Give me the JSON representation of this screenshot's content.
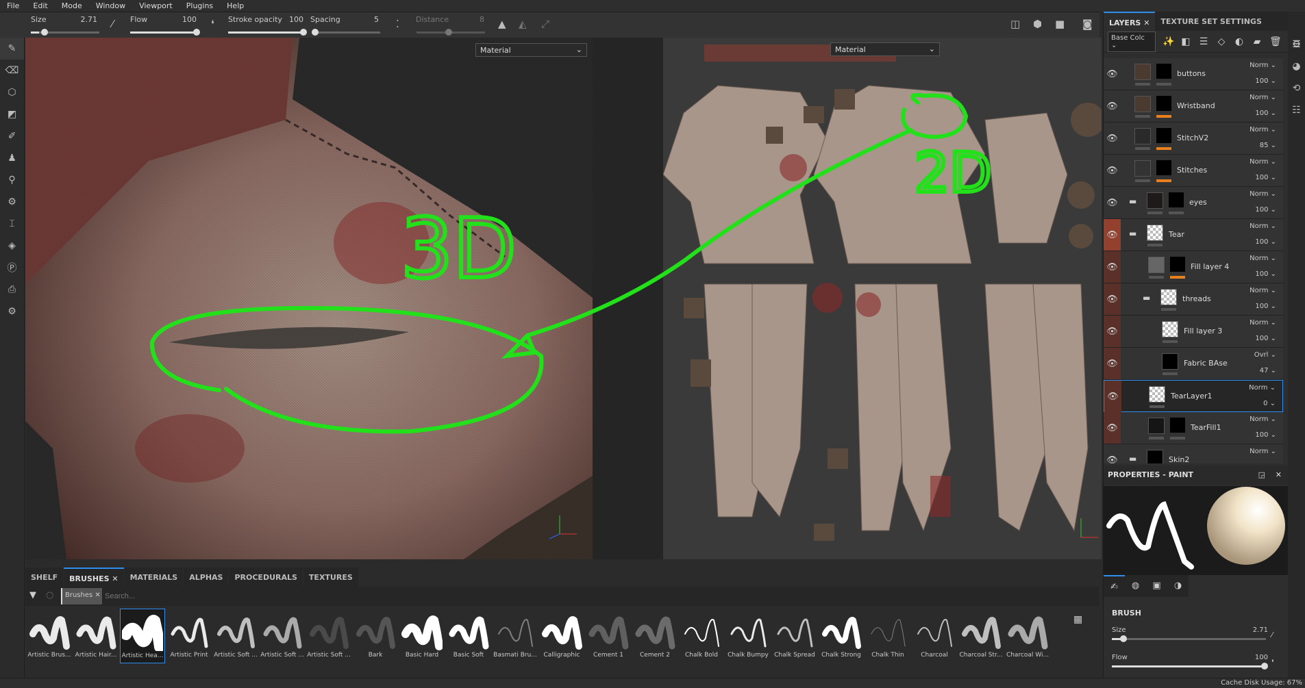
{
  "menu": [
    "File",
    "Edit",
    "Mode",
    "Window",
    "Viewport",
    "Plugins",
    "Help"
  ],
  "toolbar": {
    "size_label": "Size",
    "size_value": "2.71",
    "size_fraction": 0.1,
    "flow_label": "Flow",
    "flow_value": "100",
    "stroke_opacity_label": "Stroke opacity",
    "stroke_opacity_value": "100",
    "spacing_label": "Spacing",
    "spacing_value": "5",
    "distance_label": "Distance",
    "distance_value": "8"
  },
  "viewport3d": {
    "channel": "Material",
    "annotation_text": "3D"
  },
  "viewport2d": {
    "channel": "Material",
    "annotation_text": "2D"
  },
  "layers_panel": {
    "tabs": [
      "LAYERS",
      "TEXTURE SET SETTINGS"
    ],
    "channel_select": "Base Colc",
    "layers": [
      {
        "name": "buttons",
        "blend": "Norm",
        "opacity": "100"
      },
      {
        "name": "Wristband",
        "blend": "Norm",
        "opacity": "100"
      },
      {
        "name": "StitchV2",
        "blend": "Norm",
        "opacity": "85"
      },
      {
        "name": "Stitches",
        "blend": "Norm",
        "opacity": "100"
      },
      {
        "name": "eyes",
        "blend": "Norm",
        "opacity": "100"
      },
      {
        "name": "Tear",
        "blend": "Norm",
        "opacity": "100"
      },
      {
        "name": "Fill layer 4",
        "blend": "Norm",
        "opacity": "100"
      },
      {
        "name": "threads",
        "blend": "Norm",
        "opacity": "100"
      },
      {
        "name": "Fill layer 3",
        "blend": "Norm",
        "opacity": "100"
      },
      {
        "name": "Fabric BAse",
        "blend": "Ovrl",
        "opacity": "47"
      },
      {
        "name": "TearLayer1",
        "blend": "Norm",
        "opacity": "0"
      },
      {
        "name": "TearFill1",
        "blend": "Norm",
        "opacity": "100"
      },
      {
        "name": "Skin2",
        "blend": "Norm",
        "opacity": ""
      }
    ]
  },
  "properties": {
    "title": "PROPERTIES - PAINT",
    "section": "BRUSH",
    "size_label": "Size",
    "size_value": "2.71",
    "flow_label": "Flow",
    "flow_value": "100"
  },
  "shelf": {
    "tabs": [
      "SHELF",
      "BRUSHES",
      "MATERIALS",
      "ALPHAS",
      "PROCEDURALS",
      "TEXTURES"
    ],
    "filter_chip": "Brushes",
    "search_placeholder": "Search...",
    "brushes": [
      "Artistic Brus...",
      "Artistic Hair...",
      "Artistic Hea...",
      "Artistic Print",
      "Artistic Soft ...",
      "Artistic Soft ...",
      "Artistic Soft ...",
      "Bark",
      "Basic Hard",
      "Basic Soft",
      "Basmati Bru...",
      "Calligraphic",
      "Cement 1",
      "Cement 2",
      "Chalk Bold",
      "Chalk Bumpy",
      "Chalk Spread",
      "Chalk Strong",
      "Chalk Thin",
      "Charcoal",
      "Charcoal Str...",
      "Charcoal Wi..."
    ],
    "selected_brush": "Artistic Hea..."
  },
  "status": {
    "cache": "Cache Disk Usage:  67%"
  },
  "colors": {
    "accent": "#2f8ff0",
    "annotation": "#22e01a",
    "mask_bar": "#e8801e"
  }
}
